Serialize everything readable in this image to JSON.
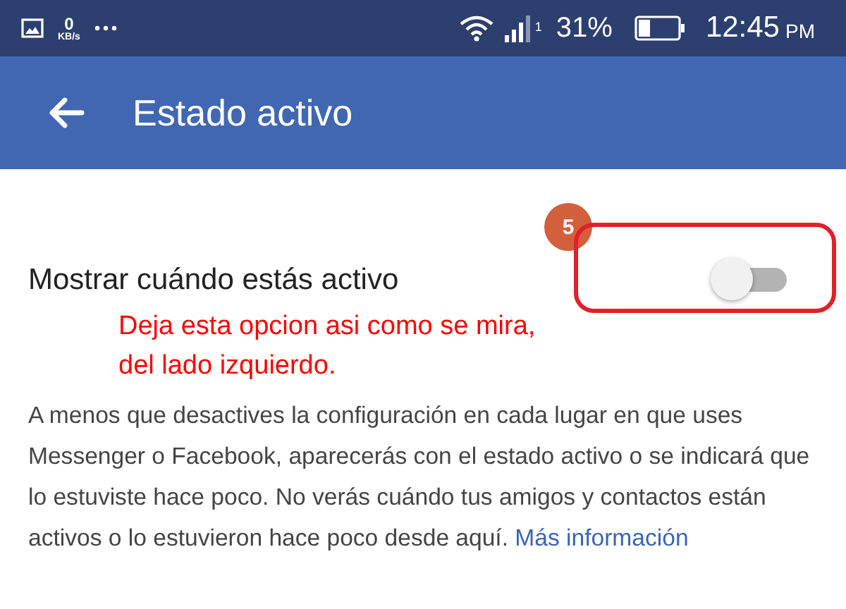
{
  "status_bar": {
    "speed_value": "0",
    "speed_unit": "KB/s",
    "sim_number": "1",
    "battery": "31%",
    "time": "12:45",
    "meridiem": "PM"
  },
  "app_bar": {
    "title": "Estado activo"
  },
  "setting": {
    "title": "Mostrar cuándo estás activo",
    "on": false,
    "description": "A menos que desactives la configuración en cada lugar en que uses Messenger o Facebook, aparecerás con el estado activo o se indicará que lo estuviste hace poco. No verás cuándo tus amigos y contactos están activos o lo estuvieron hace poco desde aquí.",
    "link": "Más información"
  },
  "annotation": {
    "step": "5",
    "note": "Deja esta opcion asi como se mira, del lado izquierdo."
  }
}
